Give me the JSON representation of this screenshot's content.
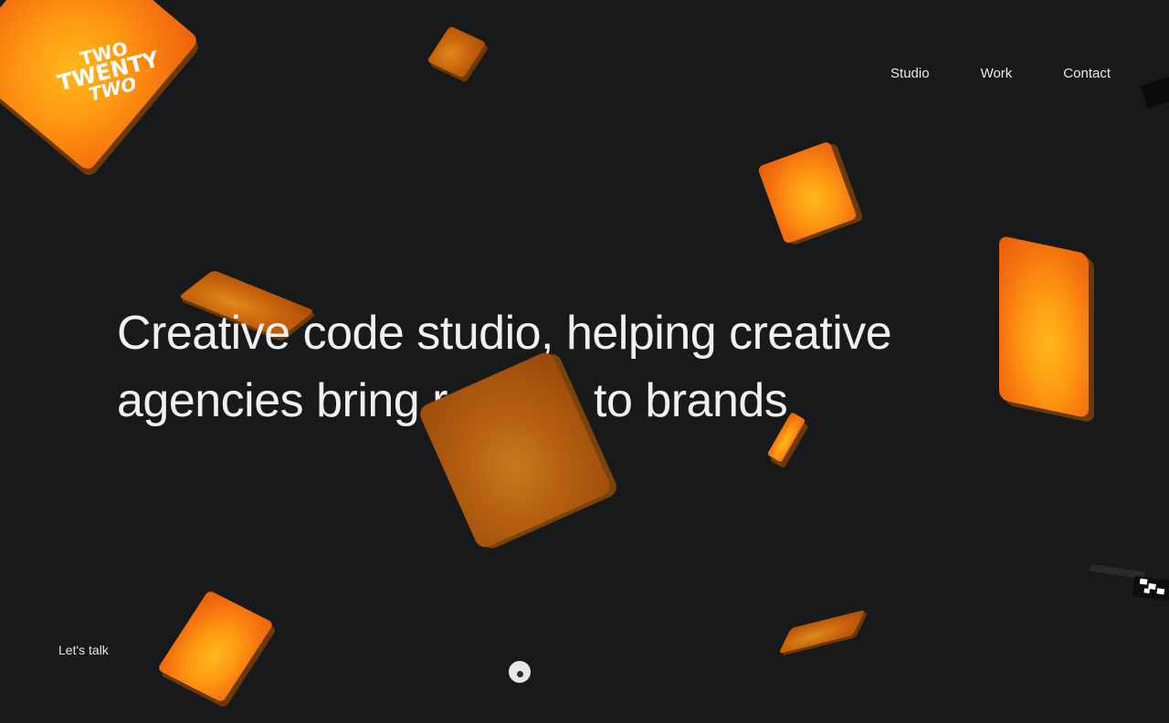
{
  "brand": {
    "logo_lines": [
      "TWO",
      "TWENTY",
      "TWO"
    ],
    "accent": "#ff9a12"
  },
  "nav": {
    "items": [
      {
        "label": "Studio"
      },
      {
        "label": "Work"
      },
      {
        "label": "Contact"
      }
    ]
  },
  "hero": {
    "line1": "Creative code studio, helping creative",
    "line2_start": "agencies bring r",
    "line2_end": "to brands"
  },
  "footer": {
    "cta_label": "Let's talk"
  },
  "colors": {
    "background": "#18191b",
    "text": "#f0f0f0"
  }
}
